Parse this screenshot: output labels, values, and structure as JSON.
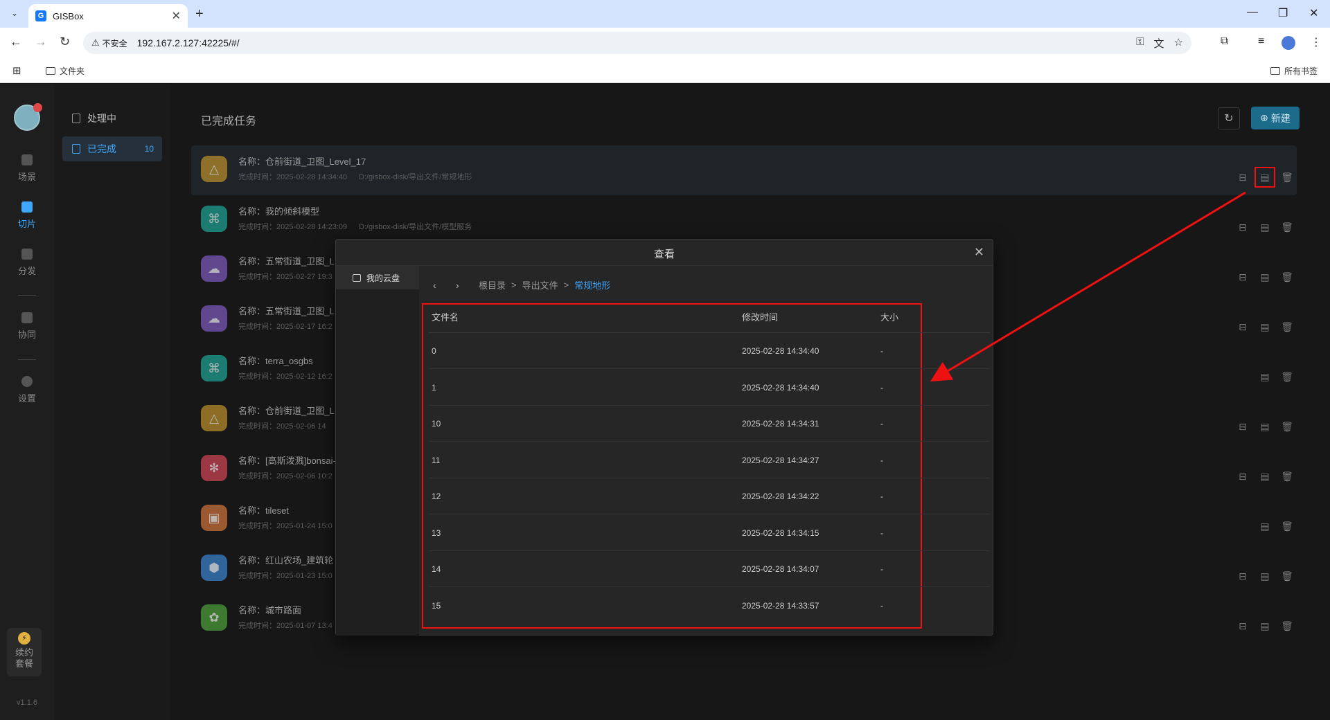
{
  "browser": {
    "tab_title": "GISBox",
    "security_label": "不安全",
    "url": "192.167.2.127:42225/#/",
    "bookmark_folder": "文件夹",
    "all_bookmarks": "所有书签"
  },
  "leftnav": {
    "items": [
      {
        "label": "场景"
      },
      {
        "label": "切片"
      },
      {
        "label": "分发"
      },
      {
        "label": "协同"
      },
      {
        "label": "设置"
      }
    ],
    "renew_line1": "续约",
    "renew_line2": "套餐",
    "version": "v1.1.6"
  },
  "subnav": {
    "processing": "处理中",
    "completed": "已完成",
    "completed_count": "10"
  },
  "main": {
    "title": "已完成任务",
    "new_button": "新建"
  },
  "tasks": [
    {
      "name": "名称：仓前街道_卫图_Level_17",
      "time": "完成时间：2025-02-28 14:34:40",
      "path": "D:/gisbox-disk/导出文件/常规地形",
      "color": "#b58a2c",
      "icon": "terrain-icon"
    },
    {
      "name": "名称：我的倾斜模型",
      "time": "完成时间：2025-02-28 14:23:09",
      "path": "D:/gisbox-disk/导出文件/模型服务",
      "color": "#1f9e8f",
      "icon": "network-icon"
    },
    {
      "name": "名称：五常街道_卫图_L",
      "time": "完成时间：2025-02-27 19:3",
      "path": "",
      "color": "#7a57b5",
      "icon": "cloud-icon"
    },
    {
      "name": "名称：五常街道_卫图_L",
      "time": "完成时间：2025-02-17 16:2",
      "path": "",
      "color": "#7a57b5",
      "icon": "cloud-icon"
    },
    {
      "name": "名称：terra_osgbs",
      "time": "完成时间：2025-02-12 16:2",
      "path": "",
      "color": "#1f9e8f",
      "icon": "network-icon"
    },
    {
      "name": "名称：仓前街道_卫图_L",
      "time": "完成时间：2025-02-06 14",
      "path": "",
      "color": "#b58a2c",
      "icon": "terrain-icon"
    },
    {
      "name": "名称：[高斯泼溅]bonsai-",
      "time": "完成时间：2025-02-06 10:2",
      "path": "",
      "color": "#c84454",
      "icon": "molecule-icon"
    },
    {
      "name": "名称：tileset",
      "time": "完成时间：2025-01-24 15:0",
      "path": "",
      "color": "#c8703a",
      "icon": "tile-icon"
    },
    {
      "name": "名称：红山农场_建筑轮",
      "time": "完成时间：2025-01-23 15:0",
      "path": "",
      "color": "#3a7ec8",
      "icon": "cube-icon"
    },
    {
      "name": "名称：城市路面",
      "time": "完成时间：2025-01-07 13:4",
      "path": "",
      "color": "#4a9a3a",
      "icon": "tree-icon"
    }
  ],
  "modal": {
    "title": "查看",
    "side_item": "我的云盘",
    "crumbs": [
      "根目录",
      "导出文件",
      "常规地形"
    ],
    "crumb_sep": ">",
    "headers": {
      "name": "文件名",
      "time": "修改时间",
      "size": "大小"
    },
    "rows": [
      {
        "name": "0",
        "time": "2025-02-28 14:34:40",
        "size": "-"
      },
      {
        "name": "1",
        "time": "2025-02-28 14:34:40",
        "size": "-"
      },
      {
        "name": "10",
        "time": "2025-02-28 14:34:31",
        "size": "-"
      },
      {
        "name": "11",
        "time": "2025-02-28 14:34:27",
        "size": "-"
      },
      {
        "name": "12",
        "time": "2025-02-28 14:34:22",
        "size": "-"
      },
      {
        "name": "13",
        "time": "2025-02-28 14:34:15",
        "size": "-"
      },
      {
        "name": "14",
        "time": "2025-02-28 14:34:07",
        "size": "-"
      },
      {
        "name": "15",
        "time": "2025-02-28 14:33:57",
        "size": "-"
      }
    ]
  },
  "colors": {
    "accent": "#3fa7ff",
    "annotation": "#e11111"
  }
}
